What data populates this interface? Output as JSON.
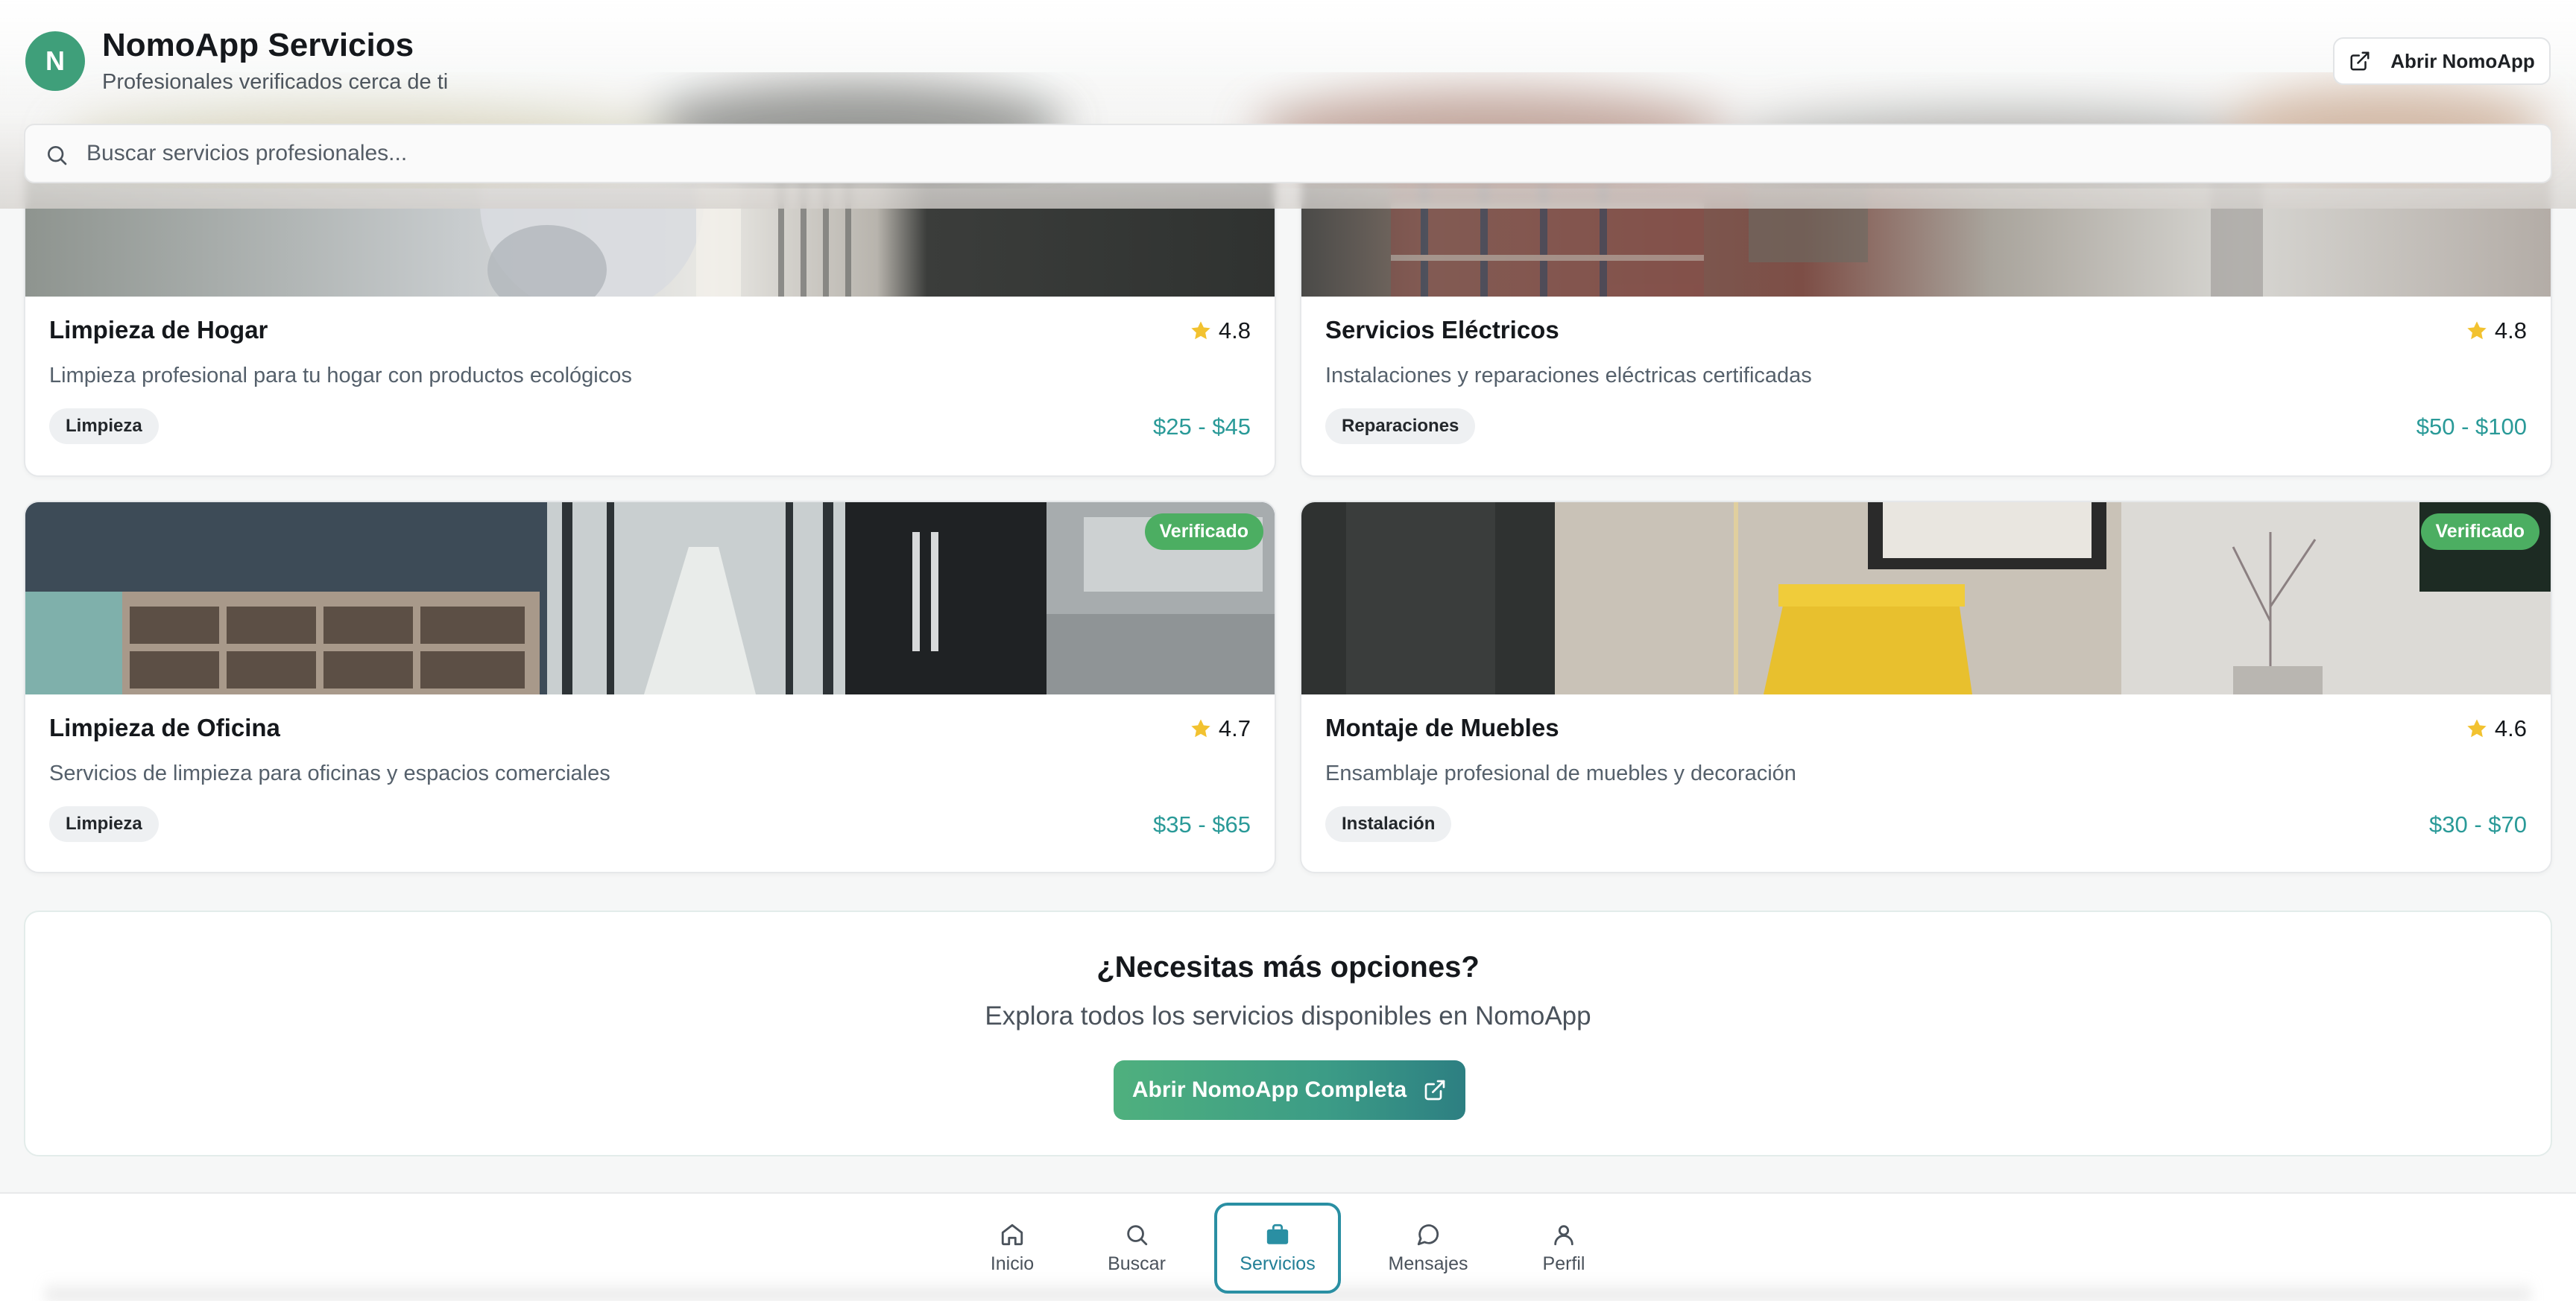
{
  "header": {
    "avatar_initial": "N",
    "title": "NomoApp Servicios",
    "subtitle": "Profesionales verificados cerca de ti",
    "open_button": "Abrir NomoApp",
    "search_placeholder": "Buscar servicios profesionales..."
  },
  "services": [
    {
      "title": "Limpieza de Hogar",
      "rating": "4.8",
      "description": "Limpieza profesional para tu hogar con productos ecológicos",
      "tag": "Limpieza",
      "price": "$25 - $45",
      "verified": false
    },
    {
      "title": "Servicios Eléctricos",
      "rating": "4.8",
      "description": "Instalaciones y reparaciones eléctricas certificadas",
      "tag": "Reparaciones",
      "price": "$50 - $100",
      "verified": false
    },
    {
      "title": "Limpieza de Oficina",
      "rating": "4.7",
      "description": "Servicios de limpieza para oficinas y espacios comerciales",
      "tag": "Limpieza",
      "price": "$35 - $65",
      "verified": true,
      "badge": "Verificado"
    },
    {
      "title": "Montaje de Muebles",
      "rating": "4.6",
      "description": "Ensamblaje profesional de muebles y decoración",
      "tag": "Instalación",
      "price": "$30 - $70",
      "verified": true,
      "badge": "Verificado"
    }
  ],
  "cta": {
    "title": "¿Necesitas más opciones?",
    "subtitle": "Explora todos los servicios disponibles en NomoApp",
    "button": "Abrir NomoApp Completa"
  },
  "nav": {
    "items": [
      {
        "label": "Inicio",
        "icon": "home-icon"
      },
      {
        "label": "Buscar",
        "icon": "search-icon"
      },
      {
        "label": "Servicios",
        "icon": "briefcase-icon",
        "active": true
      },
      {
        "label": "Mensajes",
        "icon": "message-icon"
      },
      {
        "label": "Perfil",
        "icon": "user-icon"
      }
    ]
  },
  "colors": {
    "accent": "#2a8fa3",
    "price": "#2a9a98",
    "verified_badge": "#4cae62",
    "avatar": "#3f9f7a",
    "star": "#f2c230"
  }
}
